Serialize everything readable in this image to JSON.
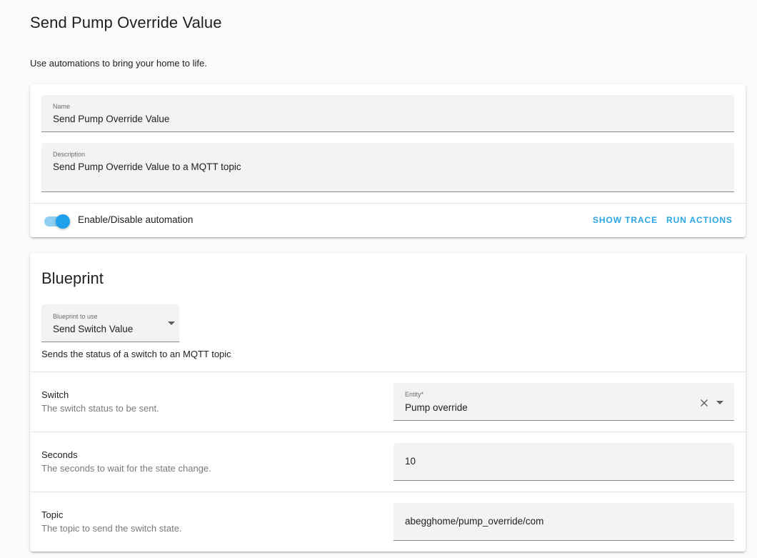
{
  "page": {
    "title": "Send Pump Override Value",
    "intro": "Use automations to bring your home to life."
  },
  "settings": {
    "name_label": "Name",
    "name_value": "Send Pump Override Value",
    "description_label": "Description",
    "description_value": "Send Pump Override Value to a MQTT topic",
    "toggle_label": "Enable/Disable automation",
    "toggle_on": true,
    "show_trace_label": "SHOW TRACE",
    "run_actions_label": "RUN ACTIONS"
  },
  "blueprint": {
    "title": "Blueprint",
    "select_label": "Blueprint to use",
    "select_value": "Send Switch Value",
    "description": "Sends the status of a switch to an MQTT topic",
    "inputs": [
      {
        "title": "Switch",
        "description": "The switch status to be sent.",
        "field_label": "Entity*",
        "field_value": "Pump override"
      },
      {
        "title": "Seconds",
        "description": "The seconds to wait for the state change.",
        "field_value": "10"
      },
      {
        "title": "Topic",
        "description": "The topic to send the switch state.",
        "field_value": "abegghome/pump_override/com"
      }
    ]
  },
  "icons": {
    "dropdown": "chevron-down-icon",
    "clear": "close-icon"
  },
  "colors": {
    "accent": "#2aa5e6",
    "toggle_knob": "#1ea0ea",
    "toggle_track": "#8fcff2",
    "background": "#fafafa"
  }
}
